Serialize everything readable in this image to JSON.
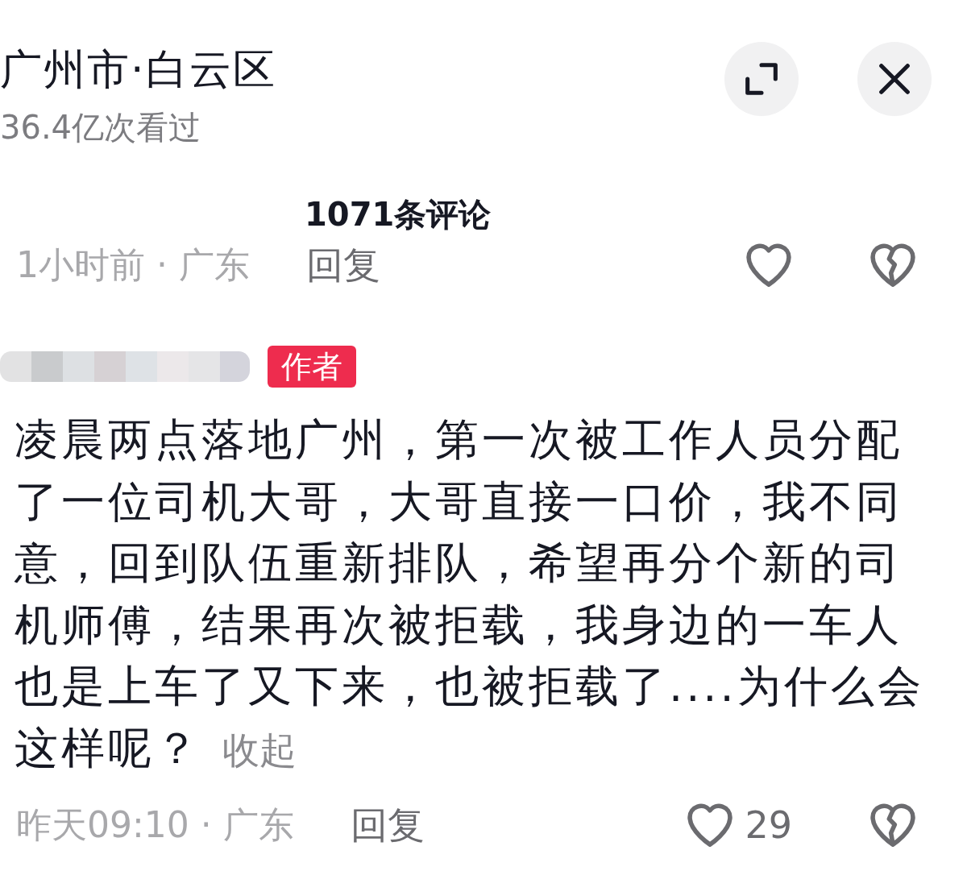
{
  "header": {
    "title": "广州市·白云区",
    "views": "36.4亿次看过"
  },
  "comments_title": "1071条评论",
  "comments": [
    {
      "kind": "cut",
      "meta": "1小时前 · 广东",
      "reply": "回复"
    },
    {
      "kind": "full",
      "badge": "作者",
      "text": "凌晨两点落地广州，第一次被工作人员分配了一位司机大哥，大哥直接一口价，我不同意，回到队伍重新排队，希望再分个新的司机师傅，结果再次被拒载，我身边的一车人也是上车了又下来，也被拒载了....为什么会这样呢？",
      "collapse": "收起",
      "meta": "昨天09:10 · 广东",
      "reply": "回复",
      "likes": "29"
    }
  ]
}
